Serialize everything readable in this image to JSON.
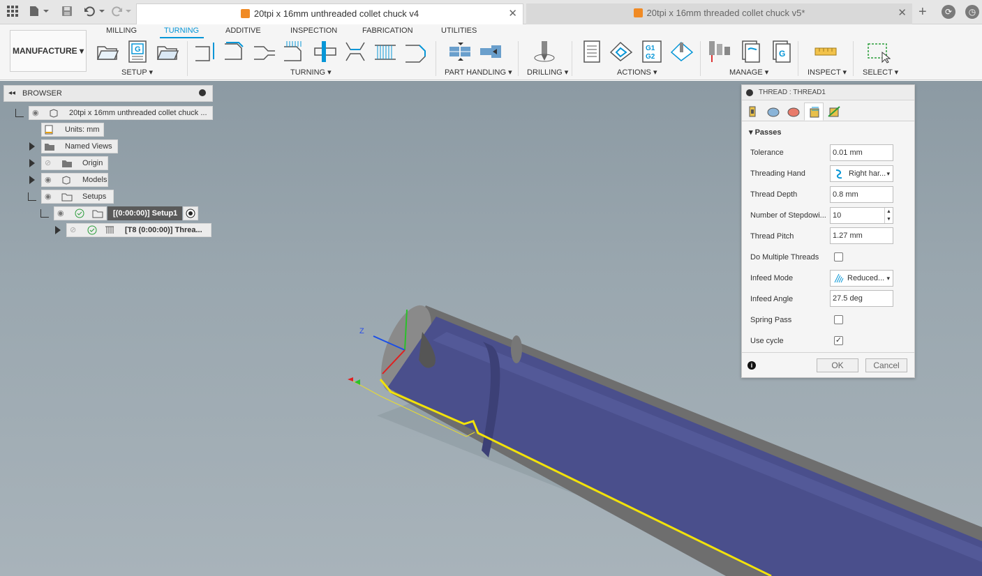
{
  "tabs": {
    "active": "20tpi x 16mm unthreaded collet chuck v4",
    "inactive": "20tpi x 16mm threaded collet chuck v5*"
  },
  "ribbon": {
    "workspace": "MANUFACTURE",
    "tabs": [
      "MILLING",
      "TURNING",
      "ADDITIVE",
      "INSPECTION",
      "FABRICATION",
      "UTILITIES"
    ],
    "active_tab": "TURNING",
    "groups": {
      "setup": "SETUP ▾",
      "turning": "TURNING ▾",
      "part_handling": "PART HANDLING ▾",
      "drilling": "DRILLING ▾",
      "actions": "ACTIONS ▾",
      "manage": "MANAGE ▾",
      "inspect": "INSPECT ▾",
      "select": "SELECT ▾"
    },
    "g_label": "G",
    "g1g2_label": "G1\nG2"
  },
  "browser": {
    "title": "BROWSER",
    "root": "20tpi x 16mm unthreaded collet chuck ...",
    "units": "Units: mm",
    "named_views": "Named Views",
    "origin": "Origin",
    "models": "Models",
    "setups": "Setups",
    "setup1": "[(0:00:00)] Setup1",
    "thread_op": "[T8 (0:00:00)] Threa..."
  },
  "dialog": {
    "title": "THREAD : THREAD1",
    "section": "Passes",
    "fields": {
      "tolerance": {
        "label": "Tolerance",
        "value": "0.01 mm"
      },
      "threading_hand": {
        "label": "Threading Hand",
        "value": "Right har..."
      },
      "thread_depth": {
        "label": "Thread Depth",
        "value": "0.8 mm"
      },
      "stepdowns": {
        "label": "Number of Stepdowi...",
        "value": "10"
      },
      "thread_pitch": {
        "label": "Thread Pitch",
        "value": "1.27 mm"
      },
      "multiple_threads": {
        "label": "Do Multiple Threads",
        "checked": false
      },
      "infeed_mode": {
        "label": "Infeed Mode",
        "value": "Reduced..."
      },
      "infeed_angle": {
        "label": "Infeed Angle",
        "value": "27.5 deg"
      },
      "spring_pass": {
        "label": "Spring Pass",
        "checked": false
      },
      "use_cycle": {
        "label": "Use cycle",
        "checked": true
      }
    },
    "ok": "OK",
    "cancel": "Cancel"
  },
  "axis_labels": {
    "z": "Z"
  },
  "colors": {
    "accent": "#0696d7",
    "part_blue": "#4a4f8c",
    "toolpath_yellow": "#f2e20a",
    "stock_gray": "#707070"
  }
}
